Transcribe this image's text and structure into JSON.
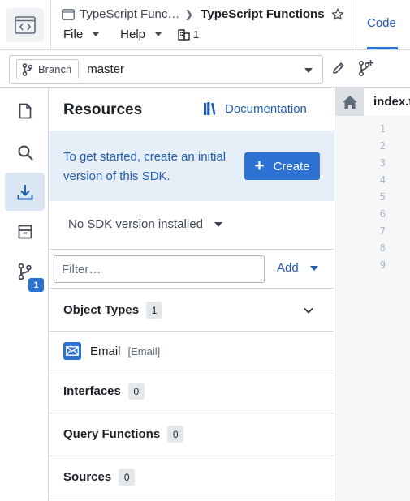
{
  "header": {
    "breadcrumb_parent": "TypeScript Func…",
    "breadcrumb_current": "TypeScript Functions",
    "menus": [
      "File",
      "Help"
    ],
    "viewer_count": "1",
    "right_tab": "Code"
  },
  "branch": {
    "pill_label": "Branch",
    "value": "master"
  },
  "rail": {
    "items": [
      "files-icon",
      "search-icon",
      "download-icon",
      "archive-icon",
      "branch-icon"
    ],
    "active_index": 2,
    "badge": "1"
  },
  "resources": {
    "title": "Resources",
    "documentation_label": "Documentation",
    "callout_text": "To get started, create an initial version of this SDK.",
    "create_label": "Create",
    "sdk_version_label": "No SDK version installed",
    "filter_placeholder": "Filter…",
    "add_label": "Add",
    "sections": [
      {
        "label": "Object Types",
        "count": "1",
        "expanded": true
      },
      {
        "label": "Interfaces",
        "count": "0"
      },
      {
        "label": "Query Functions",
        "count": "0"
      },
      {
        "label": "Sources",
        "count": "0"
      }
    ],
    "object_types": [
      {
        "name": "Email",
        "api_name": "[Email]"
      }
    ]
  },
  "editor": {
    "tab_label": "index.ts",
    "line_numbers": [
      "1",
      "2",
      "3",
      "4",
      "5",
      "6",
      "7",
      "8",
      "9"
    ]
  },
  "colors": {
    "accent": "#2d72d2",
    "accent_text": "#215db0",
    "callout_bg": "#e6eef8",
    "active_rail_bg": "#dbe6f5"
  }
}
